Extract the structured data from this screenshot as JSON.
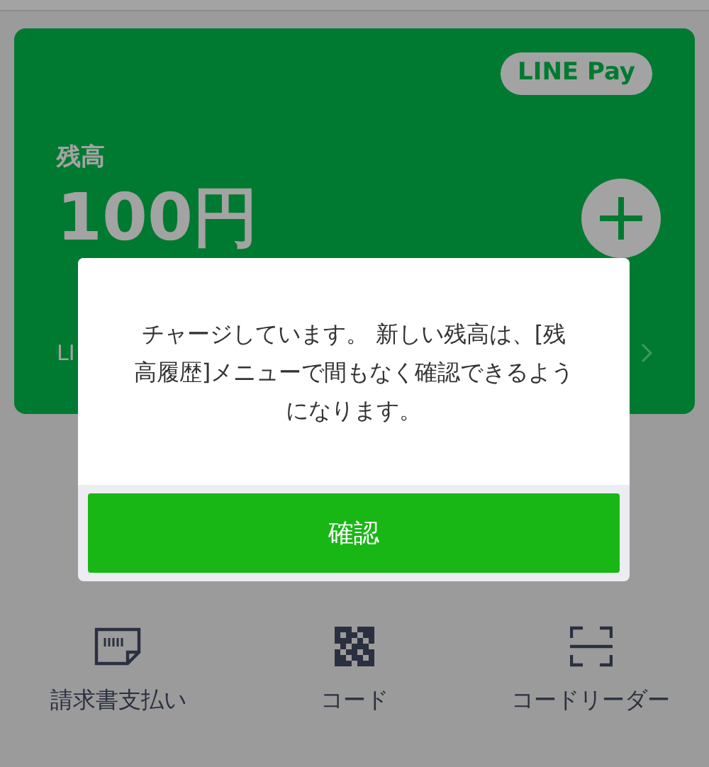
{
  "card": {
    "badge": "LINE Pay",
    "balance_label": "残高",
    "balance": "100円",
    "footer_text": "LI"
  },
  "dialog": {
    "message": "チャージしています。 新しい残高は、[残高履歴]メニューで間もなく確認できるようになります。",
    "button": "確認"
  },
  "actions": [
    {
      "kind": "bill",
      "label": "請求書支払い"
    },
    {
      "kind": "qr",
      "label": "コード"
    },
    {
      "kind": "scan",
      "label": "コードリーダー"
    }
  ]
}
